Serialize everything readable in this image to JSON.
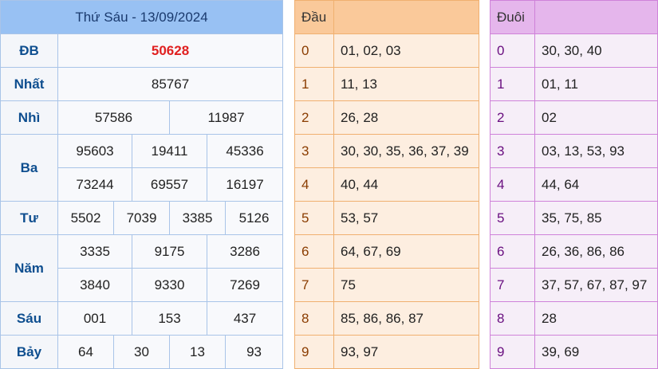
{
  "header": {
    "title": "Thứ Sáu - 13/09/2024"
  },
  "results": {
    "db": {
      "label": "ĐB",
      "values": [
        "50628"
      ]
    },
    "nhat": {
      "label": "Nhất",
      "values": [
        "85767"
      ]
    },
    "nhi": {
      "label": "Nhì",
      "values": [
        "57586",
        "11987"
      ]
    },
    "ba": {
      "label": "Ba",
      "values": [
        "95603",
        "19411",
        "45336",
        "73244",
        "69557",
        "16197"
      ]
    },
    "tu": {
      "label": "Tư",
      "values": [
        "5502",
        "7039",
        "3385",
        "5126"
      ]
    },
    "nam": {
      "label": "Năm",
      "values": [
        "3335",
        "9175",
        "3286",
        "3840",
        "9330",
        "7269"
      ]
    },
    "sau": {
      "label": "Sáu",
      "values": [
        "001",
        "153",
        "437"
      ]
    },
    "bay": {
      "label": "Bảy",
      "values": [
        "64",
        "30",
        "13",
        "93"
      ]
    }
  },
  "dau": {
    "header": "Đầu",
    "rows": [
      {
        "digit": "0",
        "values": "01, 02, 03"
      },
      {
        "digit": "1",
        "values": "11, 13"
      },
      {
        "digit": "2",
        "values": "26, 28"
      },
      {
        "digit": "3",
        "values": "30, 30, 35, 36, 37, 39"
      },
      {
        "digit": "4",
        "values": "40, 44"
      },
      {
        "digit": "5",
        "values": "53, 57"
      },
      {
        "digit": "6",
        "values": "64, 67, 69"
      },
      {
        "digit": "7",
        "values": "75"
      },
      {
        "digit": "8",
        "values": "85, 86, 86, 87"
      },
      {
        "digit": "9",
        "values": "93, 97"
      }
    ]
  },
  "duoi": {
    "header": "Đuôi",
    "rows": [
      {
        "digit": "0",
        "values": "30, 30, 40"
      },
      {
        "digit": "1",
        "values": "01, 11"
      },
      {
        "digit": "2",
        "values": "02"
      },
      {
        "digit": "3",
        "values": "03, 13, 53, 93"
      },
      {
        "digit": "4",
        "values": "44, 64"
      },
      {
        "digit": "5",
        "values": "35, 75, 85"
      },
      {
        "digit": "6",
        "values": "26, 36, 86, 86"
      },
      {
        "digit": "7",
        "values": "37, 57, 67, 87, 97"
      },
      {
        "digit": "8",
        "values": "28"
      },
      {
        "digit": "9",
        "values": "39, 69"
      }
    ]
  },
  "colors": {
    "header_blue": "#98c1f3",
    "special_red": "#e02020",
    "dau_orange": "#fac99a",
    "duoi_purple": "#e5b6ec"
  }
}
